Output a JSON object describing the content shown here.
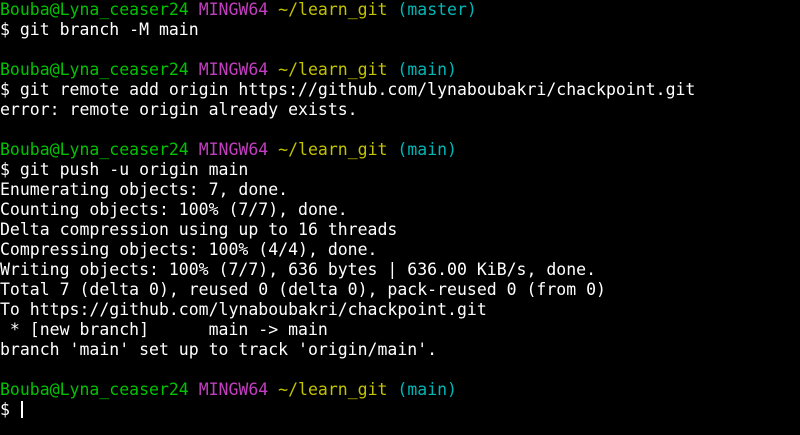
{
  "prompts": [
    {
      "user": "Bouba@Lyna_ceaser24",
      "system": "MINGW64",
      "path": "~/learn_git",
      "branch": "(master)"
    },
    {
      "user": "Bouba@Lyna_ceaser24",
      "system": "MINGW64",
      "path": "~/learn_git",
      "branch": "(main)"
    },
    {
      "user": "Bouba@Lyna_ceaser24",
      "system": "MINGW64",
      "path": "~/learn_git",
      "branch": "(main)"
    },
    {
      "user": "Bouba@Lyna_ceaser24",
      "system": "MINGW64",
      "path": "~/learn_git",
      "branch": "(main)"
    }
  ],
  "commands": [
    "$ git branch -M main",
    "$ git remote add origin https://github.com/lynaboubakri/chackpoint.git",
    "$ git push -u origin main",
    "$ "
  ],
  "output": {
    "remote_error": "error: remote origin already exists.",
    "push_lines": [
      "Enumerating objects: 7, done.",
      "Counting objects: 100% (7/7), done.",
      "Delta compression using up to 16 threads",
      "Compressing objects: 100% (4/4), done.",
      "Writing objects: 100% (7/7), 636 bytes | 636.00 KiB/s, done.",
      "Total 7 (delta 0), reused 0 (delta 0), pack-reused 0 (from 0)",
      "To https://github.com/lynaboubakri/chackpoint.git",
      " * [new branch]      main -> main",
      "branch 'main' set up to track 'origin/main'."
    ]
  },
  "colors": {
    "background": "#000000",
    "text": "#ffffff",
    "user": "#00c200",
    "system": "#c23fbf",
    "path": "#c2c200",
    "branch": "#00b7b7"
  }
}
